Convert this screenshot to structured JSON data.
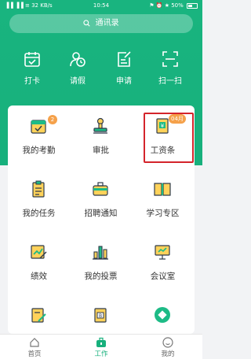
{
  "status_bar": {
    "signal": "▐▐ ▐▐ ≡",
    "speed": "32 KB/s",
    "time": "10:54",
    "right_icons": "⚑ ⏰ ★",
    "battery": "50%"
  },
  "search": {
    "placeholder": "通讯录"
  },
  "quick_actions": [
    {
      "label": "打卡",
      "icon": "calendar-check-icon"
    },
    {
      "label": "请假",
      "icon": "person-clock-icon"
    },
    {
      "label": "申请",
      "icon": "edit-document-icon"
    },
    {
      "label": "扫一扫",
      "icon": "scan-icon"
    }
  ],
  "apps": [
    {
      "label": "我的考勤",
      "icon": "attendance-icon",
      "badge": "2"
    },
    {
      "label": "审批",
      "icon": "stamp-icon"
    },
    {
      "label": "工资条",
      "icon": "payslip-icon",
      "badge": "04月"
    },
    {
      "label": "我的任务",
      "icon": "task-clipboard-icon"
    },
    {
      "label": "招聘通知",
      "icon": "briefcase-icon"
    },
    {
      "label": "学习专区",
      "icon": "open-book-icon"
    },
    {
      "label": "绩效",
      "icon": "performance-chart-icon"
    },
    {
      "label": "我的投票",
      "icon": "vote-bars-icon"
    },
    {
      "label": "会议室",
      "icon": "presentation-board-icon"
    },
    {
      "label": "",
      "icon": "note-pencil-icon"
    },
    {
      "label": "",
      "icon": "document-b-icon"
    },
    {
      "label": "",
      "icon": "green-shape-icon"
    }
  ],
  "tabbar": [
    {
      "label": "首页",
      "icon": "home-icon"
    },
    {
      "label": "工作",
      "icon": "work-bag-icon"
    },
    {
      "label": "我的",
      "icon": "profile-icon"
    }
  ],
  "colors": {
    "brand_green": "#17b07c",
    "badge_orange": "#f5a14a",
    "highlight_red": "#d4242b"
  }
}
